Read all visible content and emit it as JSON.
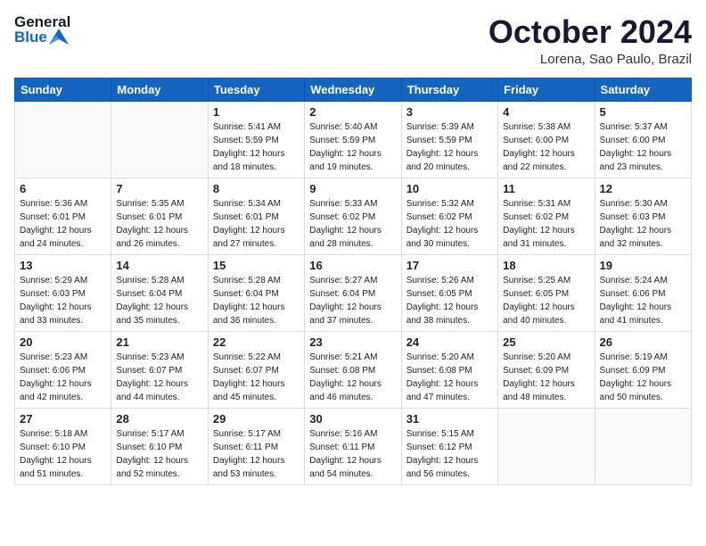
{
  "header": {
    "logo_general": "General",
    "logo_blue": "Blue",
    "month": "October 2024",
    "location": "Lorena, Sao Paulo, Brazil"
  },
  "weekdays": [
    "Sunday",
    "Monday",
    "Tuesday",
    "Wednesday",
    "Thursday",
    "Friday",
    "Saturday"
  ],
  "weeks": [
    [
      {
        "day": "",
        "empty": true
      },
      {
        "day": "",
        "empty": true
      },
      {
        "day": "1",
        "sunrise": "5:41 AM",
        "sunset": "5:59 PM",
        "daylight": "12 hours and 18 minutes."
      },
      {
        "day": "2",
        "sunrise": "5:40 AM",
        "sunset": "5:59 PM",
        "daylight": "12 hours and 19 minutes."
      },
      {
        "day": "3",
        "sunrise": "5:39 AM",
        "sunset": "5:59 PM",
        "daylight": "12 hours and 20 minutes."
      },
      {
        "day": "4",
        "sunrise": "5:38 AM",
        "sunset": "6:00 PM",
        "daylight": "12 hours and 22 minutes."
      },
      {
        "day": "5",
        "sunrise": "5:37 AM",
        "sunset": "6:00 PM",
        "daylight": "12 hours and 23 minutes."
      }
    ],
    [
      {
        "day": "6",
        "sunrise": "5:36 AM",
        "sunset": "6:01 PM",
        "daylight": "12 hours and 24 minutes."
      },
      {
        "day": "7",
        "sunrise": "5:35 AM",
        "sunset": "6:01 PM",
        "daylight": "12 hours and 26 minutes."
      },
      {
        "day": "8",
        "sunrise": "5:34 AM",
        "sunset": "6:01 PM",
        "daylight": "12 hours and 27 minutes."
      },
      {
        "day": "9",
        "sunrise": "5:33 AM",
        "sunset": "6:02 PM",
        "daylight": "12 hours and 28 minutes."
      },
      {
        "day": "10",
        "sunrise": "5:32 AM",
        "sunset": "6:02 PM",
        "daylight": "12 hours and 30 minutes."
      },
      {
        "day": "11",
        "sunrise": "5:31 AM",
        "sunset": "6:02 PM",
        "daylight": "12 hours and 31 minutes."
      },
      {
        "day": "12",
        "sunrise": "5:30 AM",
        "sunset": "6:03 PM",
        "daylight": "12 hours and 32 minutes."
      }
    ],
    [
      {
        "day": "13",
        "sunrise": "5:29 AM",
        "sunset": "6:03 PM",
        "daylight": "12 hours and 33 minutes."
      },
      {
        "day": "14",
        "sunrise": "5:28 AM",
        "sunset": "6:04 PM",
        "daylight": "12 hours and 35 minutes."
      },
      {
        "day": "15",
        "sunrise": "5:28 AM",
        "sunset": "6:04 PM",
        "daylight": "12 hours and 36 minutes."
      },
      {
        "day": "16",
        "sunrise": "5:27 AM",
        "sunset": "6:04 PM",
        "daylight": "12 hours and 37 minutes."
      },
      {
        "day": "17",
        "sunrise": "5:26 AM",
        "sunset": "6:05 PM",
        "daylight": "12 hours and 38 minutes."
      },
      {
        "day": "18",
        "sunrise": "5:25 AM",
        "sunset": "6:05 PM",
        "daylight": "12 hours and 40 minutes."
      },
      {
        "day": "19",
        "sunrise": "5:24 AM",
        "sunset": "6:06 PM",
        "daylight": "12 hours and 41 minutes."
      }
    ],
    [
      {
        "day": "20",
        "sunrise": "5:23 AM",
        "sunset": "6:06 PM",
        "daylight": "12 hours and 42 minutes."
      },
      {
        "day": "21",
        "sunrise": "5:23 AM",
        "sunset": "6:07 PM",
        "daylight": "12 hours and 44 minutes."
      },
      {
        "day": "22",
        "sunrise": "5:22 AM",
        "sunset": "6:07 PM",
        "daylight": "12 hours and 45 minutes."
      },
      {
        "day": "23",
        "sunrise": "5:21 AM",
        "sunset": "6:08 PM",
        "daylight": "12 hours and 46 minutes."
      },
      {
        "day": "24",
        "sunrise": "5:20 AM",
        "sunset": "6:08 PM",
        "daylight": "12 hours and 47 minutes."
      },
      {
        "day": "25",
        "sunrise": "5:20 AM",
        "sunset": "6:09 PM",
        "daylight": "12 hours and 48 minutes."
      },
      {
        "day": "26",
        "sunrise": "5:19 AM",
        "sunset": "6:09 PM",
        "daylight": "12 hours and 50 minutes."
      }
    ],
    [
      {
        "day": "27",
        "sunrise": "5:18 AM",
        "sunset": "6:10 PM",
        "daylight": "12 hours and 51 minutes."
      },
      {
        "day": "28",
        "sunrise": "5:17 AM",
        "sunset": "6:10 PM",
        "daylight": "12 hours and 52 minutes."
      },
      {
        "day": "29",
        "sunrise": "5:17 AM",
        "sunset": "6:11 PM",
        "daylight": "12 hours and 53 minutes."
      },
      {
        "day": "30",
        "sunrise": "5:16 AM",
        "sunset": "6:11 PM",
        "daylight": "12 hours and 54 minutes."
      },
      {
        "day": "31",
        "sunrise": "5:15 AM",
        "sunset": "6:12 PM",
        "daylight": "12 hours and 56 minutes."
      },
      {
        "day": "",
        "empty": true
      },
      {
        "day": "",
        "empty": true
      }
    ]
  ],
  "labels": {
    "sunrise": "Sunrise:",
    "sunset": "Sunset:",
    "daylight": "Daylight: 12 hours"
  }
}
